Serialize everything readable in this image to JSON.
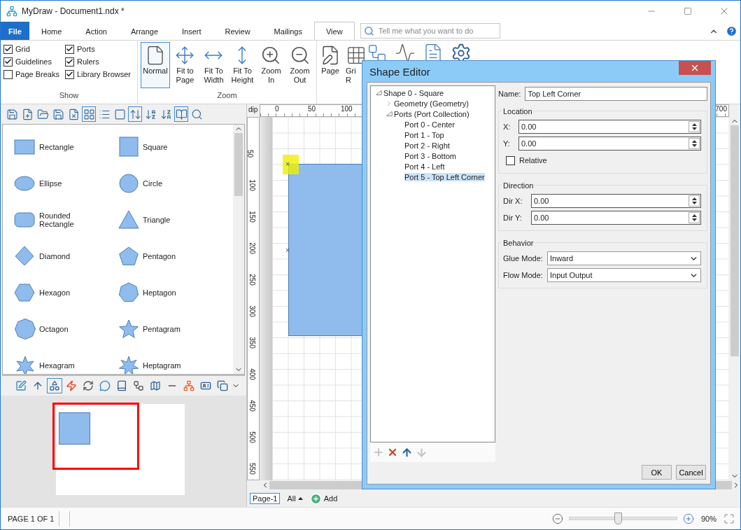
{
  "window": {
    "title": "MyDraw - Document1.ndx *"
  },
  "ribbon_tabs": [
    {
      "label": "File",
      "kind": "file",
      "selected": false
    },
    {
      "label": "Home",
      "kind": "tab",
      "selected": false
    },
    {
      "label": "Action",
      "kind": "tab",
      "selected": false
    },
    {
      "label": "Arrange",
      "kind": "tab",
      "selected": false
    },
    {
      "label": "Insert",
      "kind": "tab",
      "selected": false
    },
    {
      "label": "Review",
      "kind": "tab",
      "selected": false
    },
    {
      "label": "Mailings",
      "kind": "tab",
      "selected": false
    },
    {
      "label": "View",
      "kind": "tab",
      "selected": true
    }
  ],
  "search": {
    "placeholder": "Tell me what you want to do"
  },
  "show_group": {
    "title": "Show",
    "options": [
      {
        "label": "Grid",
        "checked": true
      },
      {
        "label": "Guidelines",
        "checked": true
      },
      {
        "label": "Page Breaks",
        "checked": false
      },
      {
        "label": "Ports",
        "checked": true
      },
      {
        "label": "Rulers",
        "checked": true
      },
      {
        "label": "Library Browser",
        "checked": true
      }
    ]
  },
  "zoom_group": {
    "title": "Zoom",
    "buttons": [
      {
        "label": "Normal",
        "kind": "normal",
        "selected": true
      },
      {
        "label": "Fit to Page",
        "kind": "fit-page",
        "selected": false
      },
      {
        "label": "Fit To Width",
        "kind": "fit-width",
        "selected": false
      },
      {
        "label": "Fit To Height",
        "kind": "fit-height",
        "selected": false
      },
      {
        "label": "Zoom In",
        "kind": "zoom-in",
        "selected": false
      },
      {
        "label": "Zoom Out",
        "kind": "zoom-out",
        "selected": false
      }
    ]
  },
  "view_group": {
    "buttons": [
      {
        "label": "Page",
        "kind": "page-edit"
      },
      {
        "label": "Gri R",
        "kind": "grid"
      }
    ]
  },
  "library_toolbar": [
    {
      "selected": false
    },
    {
      "selected": false
    },
    {
      "selected": false
    },
    {
      "selected": false
    },
    {
      "selected": false
    },
    {
      "selected": true
    },
    {
      "selected": false
    },
    {
      "selected": false
    },
    {
      "selected": true
    },
    {
      "selected": false
    },
    {
      "selected": false
    },
    {
      "selected": true
    },
    {
      "selected": false
    }
  ],
  "shapes": [
    {
      "label": "Rectangle",
      "kind": "rectangle"
    },
    {
      "label": "Square",
      "kind": "square"
    },
    {
      "label": "Ellipse",
      "kind": "ellipse"
    },
    {
      "label": "Circle",
      "kind": "circle"
    },
    {
      "label": "Rounded Rectangle",
      "kind": "rounded"
    },
    {
      "label": "Triangle",
      "kind": "triangle"
    },
    {
      "label": "Diamond",
      "kind": "diamond"
    },
    {
      "label": "Pentagon",
      "kind": "pentagon"
    },
    {
      "label": "Hexagon",
      "kind": "hexagon"
    },
    {
      "label": "Heptagon",
      "kind": "heptagon"
    },
    {
      "label": "Octagon",
      "kind": "octagon"
    },
    {
      "label": "Pentagram",
      "kind": "pentagram"
    },
    {
      "label": "Hexagram",
      "kind": "hexagram"
    },
    {
      "label": "Heptagram",
      "kind": "heptagram"
    }
  ],
  "tools_toolbar": [
    {
      "selected": false
    },
    {
      "selected": false
    },
    {
      "selected": true
    },
    {
      "selected": false
    },
    {
      "selected": false
    },
    {
      "selected": false
    },
    {
      "selected": false
    },
    {
      "selected": false
    },
    {
      "selected": false
    },
    {
      "selected": false
    },
    {
      "selected": false
    },
    {
      "selected": false
    },
    {
      "selected": false
    }
  ],
  "canvas": {
    "unit": "dip",
    "top_ruler": [
      "0",
      "50",
      "100"
    ],
    "top_ruler_end": "700",
    "port_markers": [
      "×",
      "×"
    ],
    "left_ruler": [
      "50",
      "100",
      "150",
      "200",
      "250",
      "300",
      "350",
      "400",
      "450",
      "500",
      "550"
    ]
  },
  "page_tabs": [
    {
      "label": "Page-1",
      "selected": true
    }
  ],
  "page_filter": "All",
  "add_page": "Add",
  "status_bar": {
    "page": "PAGE 1 OF 1",
    "zoom": {
      "level": 0.45,
      "reading": "90%"
    }
  },
  "dialog": {
    "title": "Shape Editor",
    "tree": [
      {
        "label": "Shape 0 - Square",
        "expanded": true,
        "selected": false,
        "children": [
          {
            "label": "Geometry (Geometry)",
            "expanded": false,
            "selected": false
          },
          {
            "label": "Ports (Port Collection)",
            "expanded": true,
            "selected": false,
            "children": [
              {
                "label": "Port 0 - Center",
                "selected": false
              },
              {
                "label": "Port 1 - Top",
                "selected": false
              },
              {
                "label": "Port 2 - Right",
                "selected": false
              },
              {
                "label": "Port 3 - Bottom",
                "selected": false
              },
              {
                "label": "Port 4 - Left",
                "selected": false
              },
              {
                "label": "Port 5 - Top Left Corner",
                "selected": true
              }
            ]
          }
        ]
      }
    ],
    "tree_actions": [
      {
        "kind": "add",
        "disabled": true
      },
      {
        "kind": "delete",
        "disabled": false
      },
      {
        "kind": "up",
        "disabled": false
      },
      {
        "kind": "down",
        "disabled": true
      }
    ],
    "name": {
      "label": "Name:",
      "value": "Top Left Corner"
    },
    "location": {
      "title": "Location",
      "fields": [
        {
          "label": "X:",
          "value": "0.00"
        },
        {
          "label": "Y:",
          "value": "0.00"
        }
      ],
      "relative": {
        "label": "Relative",
        "checked": false
      }
    },
    "direction": {
      "title": "Direction",
      "fields": [
        {
          "label": "Dir X:",
          "value": "0.00"
        },
        {
          "label": "Dir Y:",
          "value": "0.00"
        }
      ]
    },
    "behavior": {
      "title": "Behavior",
      "selects": [
        {
          "label": "Glue Mode:",
          "value": "Inward"
        },
        {
          "label": "Flow Mode:",
          "value": "Input Output"
        }
      ]
    },
    "buttons": [
      {
        "label": "OK"
      },
      {
        "label": "Cancel"
      }
    ]
  }
}
